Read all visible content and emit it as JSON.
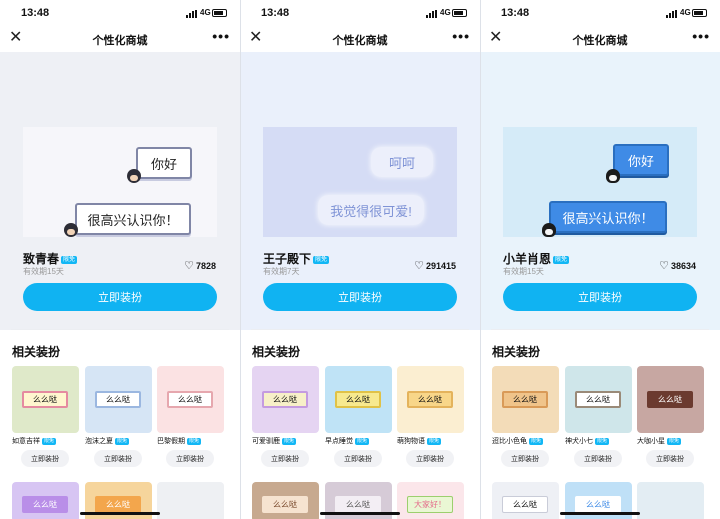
{
  "status": {
    "time": "13:48",
    "network": "4G"
  },
  "nav": {
    "title": "个性化商城"
  },
  "panels": [
    {
      "preview": {
        "bubble1": "你好",
        "bubble2": "很高兴认识你！"
      },
      "name": "致青春",
      "badge": "限免",
      "validity": "有效期15天",
      "likes": "7828",
      "cta": "立即装扮",
      "section_title": "相关装扮",
      "related": [
        {
          "name": "如意吉祥",
          "badge": "限免",
          "preview_text": "么么哒",
          "button": "立即装扮",
          "color": "#dfe9c9"
        },
        {
          "name": "泡沫之夏",
          "badge": "限免",
          "preview_text": "么么哒",
          "button": "立即装扮",
          "color": "#d6e5f5"
        },
        {
          "name": "巴黎假期",
          "badge": "限免",
          "preview_text": "么么哒",
          "button": "立即装扮",
          "color": "#fbe2e3"
        }
      ],
      "next_row": [
        {
          "preview_text": "么么哒",
          "color": "#d7c5f3"
        },
        {
          "preview_text": "么么哒",
          "color": "#f6d59c"
        },
        {
          "preview_text": "",
          "color": "#eef0f3"
        }
      ]
    },
    {
      "preview": {
        "bubble1": "呵呵",
        "bubble2": "我觉得很可爱!"
      },
      "name": "王子殿下",
      "badge": "限免",
      "validity": "有效期7天",
      "likes": "291415",
      "cta": "立即装扮",
      "section_title": "相关装扮",
      "related": [
        {
          "name": "可爱驯鹿",
          "badge": "限免",
          "preview_text": "么么哒",
          "button": "立即装扮",
          "color": "#e5d4f2"
        },
        {
          "name": "早点睡觉",
          "badge": "限免",
          "preview_text": "么么哒",
          "button": "立即装扮",
          "color": "#bfe3f6"
        },
        {
          "name": "萌狗物语",
          "badge": "限免",
          "preview_text": "么么哒",
          "button": "立即装扮",
          "color": "#fbeed1"
        }
      ],
      "next_row": [
        {
          "preview_text": "么么哒",
          "color": "#c7a98f"
        },
        {
          "preview_text": "么么哒",
          "color": "#d6cbd7"
        },
        {
          "preview_text": "大家好！",
          "color": "#fbe6ea"
        }
      ]
    },
    {
      "preview": {
        "bubble1": "你好",
        "bubble2": "很高兴认识你！"
      },
      "name": "小羊肖恩",
      "badge": "限免",
      "validity": "有效期15天",
      "likes": "38634",
      "cta": "立即装扮",
      "section_title": "相关装扮",
      "related": [
        {
          "name": "迢比小色龟",
          "badge": "限免",
          "preview_text": "么么哒",
          "button": "立即装扮",
          "color": "#f3dcb8"
        },
        {
          "name": "神犬小七",
          "badge": "限免",
          "preview_text": "么么哒",
          "button": "立即装扮",
          "color": "#cfe6ea"
        },
        {
          "name": "大咖小星",
          "badge": "限免",
          "preview_text": "么么哒",
          "button": "立即装扮",
          "color": "#c7a7a2"
        }
      ],
      "next_row": [
        {
          "preview_text": "么么哒",
          "color": "#eef0f5"
        },
        {
          "preview_text": "么么哒",
          "color": "#bfe0f7"
        },
        {
          "preview_text": "",
          "color": "#e3edf3"
        }
      ]
    }
  ]
}
